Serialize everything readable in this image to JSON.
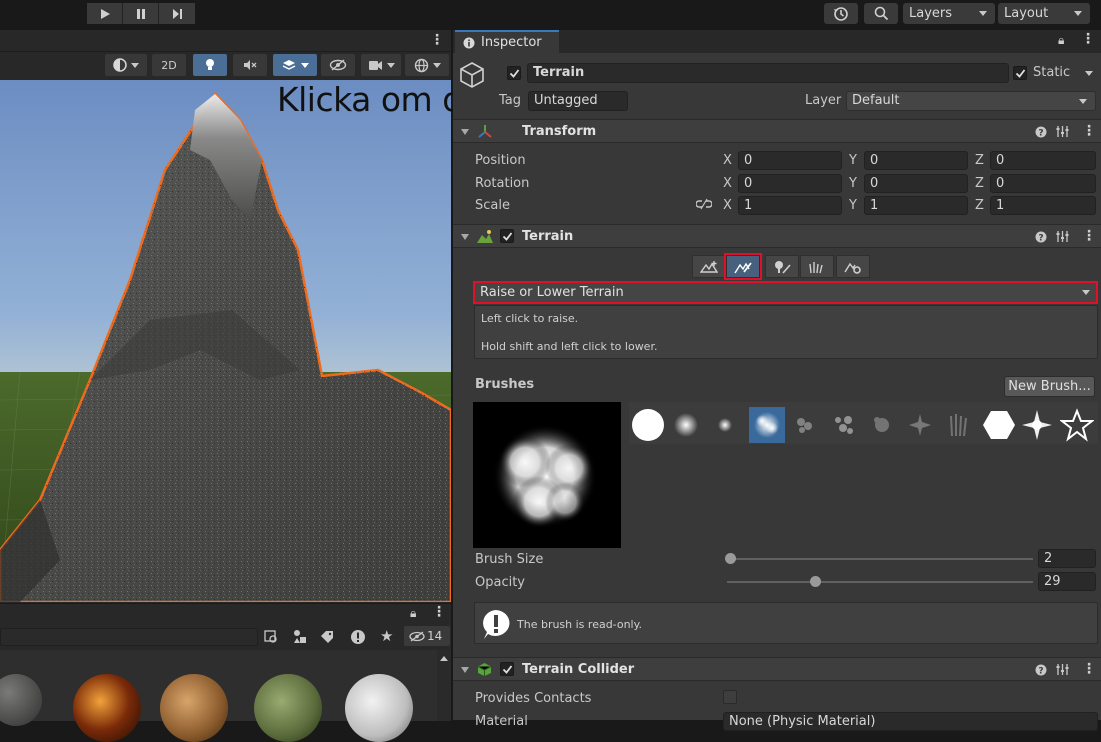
{
  "toolbar": {
    "layers_label": "Layers",
    "layout_label": "Layout"
  },
  "scene": {
    "mode_2d": "2D",
    "hidden_count": "14"
  },
  "overlay_hint": "Klicka om du vill lägga till text",
  "inspector": {
    "tab_label": "Inspector",
    "object_name": "Terrain",
    "static_label": "Static",
    "tag_label": "Tag",
    "tag_value": "Untagged",
    "layer_label": "Layer",
    "layer_value": "Default",
    "transform": {
      "title": "Transform",
      "position_label": "Position",
      "rotation_label": "Rotation",
      "scale_label": "Scale",
      "axis_x": "X",
      "axis_y": "Y",
      "axis_z": "Z",
      "position": [
        "0",
        "0",
        "0"
      ],
      "rotation": [
        "0",
        "0",
        "0"
      ],
      "scale": [
        "1",
        "1",
        "1"
      ]
    },
    "terrain": {
      "title": "Terrain",
      "tool_dropdown": "Raise or Lower Terrain",
      "help_line1": "Left click to raise.",
      "help_line2": "Hold shift and left click to lower.",
      "brushes_label": "Brushes",
      "new_brush_button": "New Brush...",
      "brush_size_label": "Brush Size",
      "brush_size_value": "2",
      "brush_size_fraction": 0.01,
      "opacity_label": "Opacity",
      "opacity_value": "29",
      "opacity_fraction": 0.29,
      "readonly_note": "The brush is read-only."
    },
    "terrain_collider": {
      "title": "Terrain Collider",
      "provides_contacts_label": "Provides Contacts",
      "material_label": "Material",
      "material_value": "None (Physic Material)"
    }
  },
  "colors": {
    "accent": "#3a79bb",
    "highlight_red": "#e0102a",
    "selection_orange": "#f26a1b"
  }
}
